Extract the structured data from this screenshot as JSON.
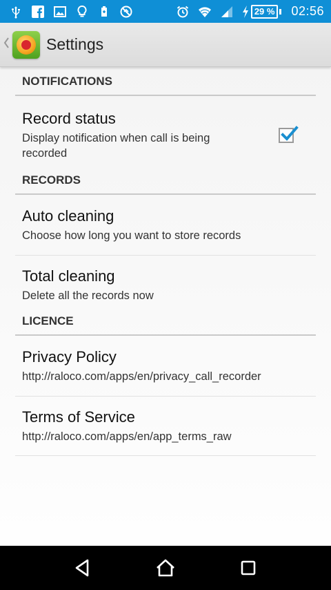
{
  "status_bar": {
    "battery_percent": "29 %",
    "time": "02:56",
    "icons_left": [
      "usb-icon",
      "facebook-icon",
      "image-icon",
      "lightbulb-icon",
      "battery-saver-icon",
      "no-sync-icon"
    ],
    "icons_right": [
      "alarm-icon",
      "wifi-icon",
      "signal-icon",
      "charging-icon"
    ],
    "color": "#0f8fd6"
  },
  "action_bar": {
    "title": "Settings"
  },
  "sections": {
    "notifications": {
      "header": "NOTIFICATIONS",
      "record_status": {
        "title": "Record status",
        "summary": "Display notification when call is being recorded",
        "checked": true
      }
    },
    "records": {
      "header": "RECORDS",
      "auto_cleaning": {
        "title": "Auto cleaning",
        "summary": "Choose how long you want to store records"
      },
      "total_cleaning": {
        "title": "Total cleaning",
        "summary": "Delete all the records now"
      }
    },
    "licence": {
      "header": "LICENCE",
      "privacy_policy": {
        "title": "Privacy Policy",
        "summary": "http://raloco.com/apps/en/privacy_call_recorder"
      },
      "terms_of_service": {
        "title": "Terms of Service",
        "summary": "http://raloco.com/apps/en/app_terms_raw"
      }
    }
  },
  "accent_color": "#1a8fd0"
}
